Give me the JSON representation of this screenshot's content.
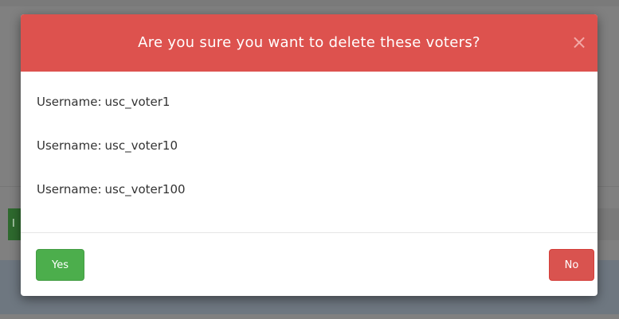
{
  "modal": {
    "title": "Are you sure you want to delete these voters?",
    "close_symbol": "×",
    "voters": [
      {
        "label": "Username:",
        "value": "usc_voter1"
      },
      {
        "label": "Username:",
        "value": "usc_voter10"
      },
      {
        "label": "Username:",
        "value": "usc_voter100"
      }
    ],
    "buttons": {
      "yes_label": "Yes",
      "no_label": "No"
    }
  },
  "background": {
    "partial_button_text": "I"
  },
  "colors": {
    "header": "#dd524e",
    "yes_button": "#4cae4c",
    "no_button": "#d9534f",
    "overlay": "#808080"
  },
  "icons": {
    "close": "close-icon"
  }
}
